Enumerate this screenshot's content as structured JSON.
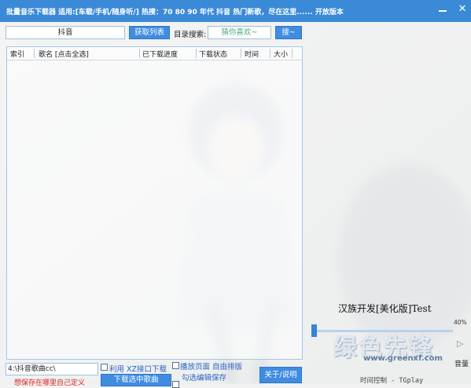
{
  "window": {
    "title": "批量音乐下载器  适用:[车载/手机/随身听/] 热搜：70 80 90 年代 抖音 热门新歌，尽在这里...... 开放版本",
    "minimize_icon": "minimize-icon",
    "close_icon": "close-icon"
  },
  "search": {
    "keyword": "抖音",
    "fetch_button": "获取列表",
    "dir_label": "目录搜索:",
    "dir_input": "猜你喜欢~",
    "dir_button": "搜~"
  },
  "table": {
    "columns": [
      "索引",
      "歌名 [点击全选]",
      "已下载进度",
      "下载状态",
      "时间",
      "大小"
    ],
    "rows": []
  },
  "side": {
    "brand": "汉族开发[美化版]Test",
    "volume_text": "40%",
    "volume_percent": 40,
    "volume_label": "音量",
    "next_icon": "arrow-right-icon",
    "time_control": "时间控制 - TGplay"
  },
  "watermark": {
    "name": "绿色先锋",
    "url": "www.greenxf.com"
  },
  "bottom": {
    "save_path": "4:\\抖音歌曲cc\\",
    "save_hint": "想保存在哪里自己定义",
    "xz_checkbox_label": "利用 XZ接口下载",
    "download_button": "下载选中歌曲",
    "free_layout_label": "播放页面 自由排版",
    "edit_save_label": "勾选编辑保存",
    "about_button": "关于/说明"
  },
  "colors": {
    "titlebar": "#3a8ad8",
    "button": "#3f8ce0",
    "hint_red": "#e02020",
    "link_blue": "#2a63c4",
    "placeholder_green": "#46a88a"
  }
}
